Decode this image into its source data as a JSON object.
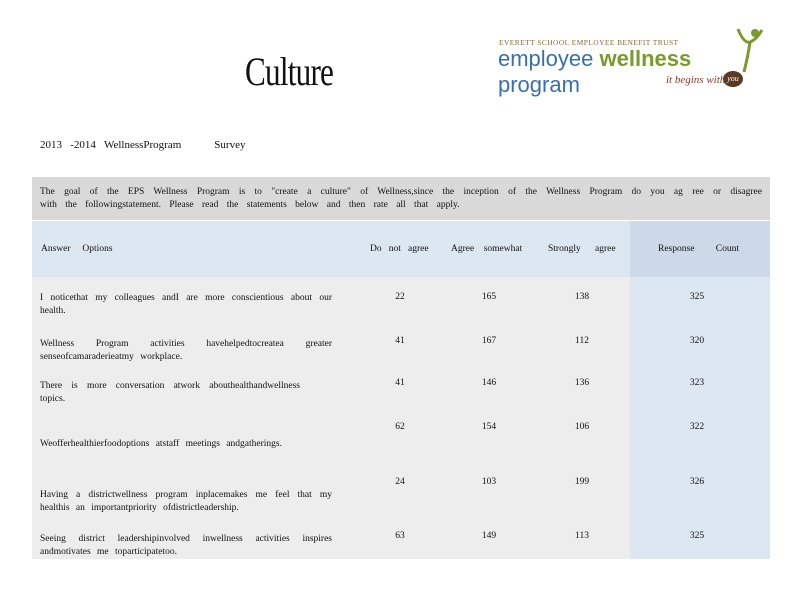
{
  "page": {
    "title": "Culture"
  },
  "logo": {
    "trust_name": "EVERETT SCHOOL EMPLOYEE BENEFIT TRUST",
    "word1": "employee",
    "word2": "wellness",
    "word3": "program",
    "tagline": "it begins with",
    "tag_you": "you",
    "brand_colors": {
      "blue": "#3a6fa8",
      "green": "#7a9a2e",
      "brown": "#5a3a22"
    }
  },
  "survey": {
    "title": "2013   -2014   WellnessProgram            Survey"
  },
  "intro": {
    "text": "The goal of the EPS Wellness Program is to \"create a culture\" of Wellness,since the inception of the Wellness Program do you ag ree or disagree with the followingstatement. Please read the statements below and then rate all that apply."
  },
  "table": {
    "headers": {
      "options": "Answer     Options",
      "not_agree": "Do   not   agree",
      "somewhat": "Agree    somewhat",
      "strongly": "Strongly      agree",
      "count": "Response         Count"
    },
    "rows": [
      {
        "q": "I noticethat my colleagues andI are more conscientious about our health.",
        "not": "22",
        "some": "165",
        "strong": "138",
        "count": "325"
      },
      {
        "q": "Wellness Program activities havehelpedtocreatea greater senseofcamaraderieatmy workplace.",
        "not": "41",
        "some": "167",
        "strong": "112",
        "count": "320"
      },
      {
        "q": "There is more conversation atwork abouthealthandwellness topics.",
        "not": "41",
        "some": "146",
        "strong": "136",
        "count": "323"
      },
      {
        "q": "Weofferhealthierfoodoptions atstaff meetings andgatherings.",
        "not": "62",
        "some": "154",
        "strong": "106",
        "count": "322"
      },
      {
        "q": "Having a districtwellness program inplacemakes me feel that my healthis an importantpriority ofdistrictleadership.",
        "not": "24",
        "some": "103",
        "strong": "199",
        "count": "326"
      },
      {
        "q": "Seeing district leadershipinvolved inwellness activities inspires andmotivates me toparticipatetoo.",
        "not": "63",
        "some": "149",
        "strong": "113",
        "count": "325"
      }
    ]
  }
}
